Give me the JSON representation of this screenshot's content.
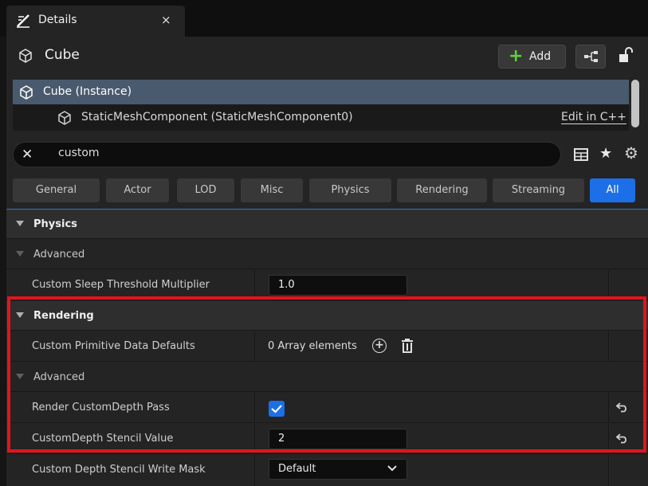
{
  "tab": {
    "title": "Details",
    "close": "×"
  },
  "actor": {
    "name": "Cube"
  },
  "toolbar": {
    "add_label": "Add",
    "add_plus": "+"
  },
  "tree": {
    "root": "Cube (Instance)",
    "component": "StaticMeshComponent (StaticMeshComponent0)",
    "edit_link": "Edit in C++"
  },
  "search": {
    "clear": "✕",
    "value": "custom",
    "placeholder": "Search"
  },
  "icons": {
    "star": "★",
    "gear": "⚙"
  },
  "filters": [
    "General",
    "Actor",
    "LOD",
    "Misc",
    "Physics",
    "Rendering",
    "Streaming",
    "All"
  ],
  "active_filter": "All",
  "properties": {
    "physics": {
      "category": "Physics",
      "advanced": "Advanced",
      "sleep_label": "Custom Sleep Threshold Multiplier",
      "sleep_value": "1.0"
    },
    "rendering": {
      "category": "Rendering",
      "primitive_label": "Custom Primitive Data Defaults",
      "primitive_value": "0 Array elements",
      "primitive_add": "+",
      "advanced": "Advanced",
      "depth_pass_label": "Render CustomDepth Pass",
      "depth_pass_checked": true,
      "stencil_label": "CustomDepth Stencil Value",
      "stencil_value": "2",
      "mask_label": "Custom Depth Stencil Write Mask",
      "mask_value": "Default"
    }
  },
  "colors": {
    "accent": "#1d6fe8",
    "highlight": "#e2141c",
    "add_green": "#5fcf3a"
  }
}
